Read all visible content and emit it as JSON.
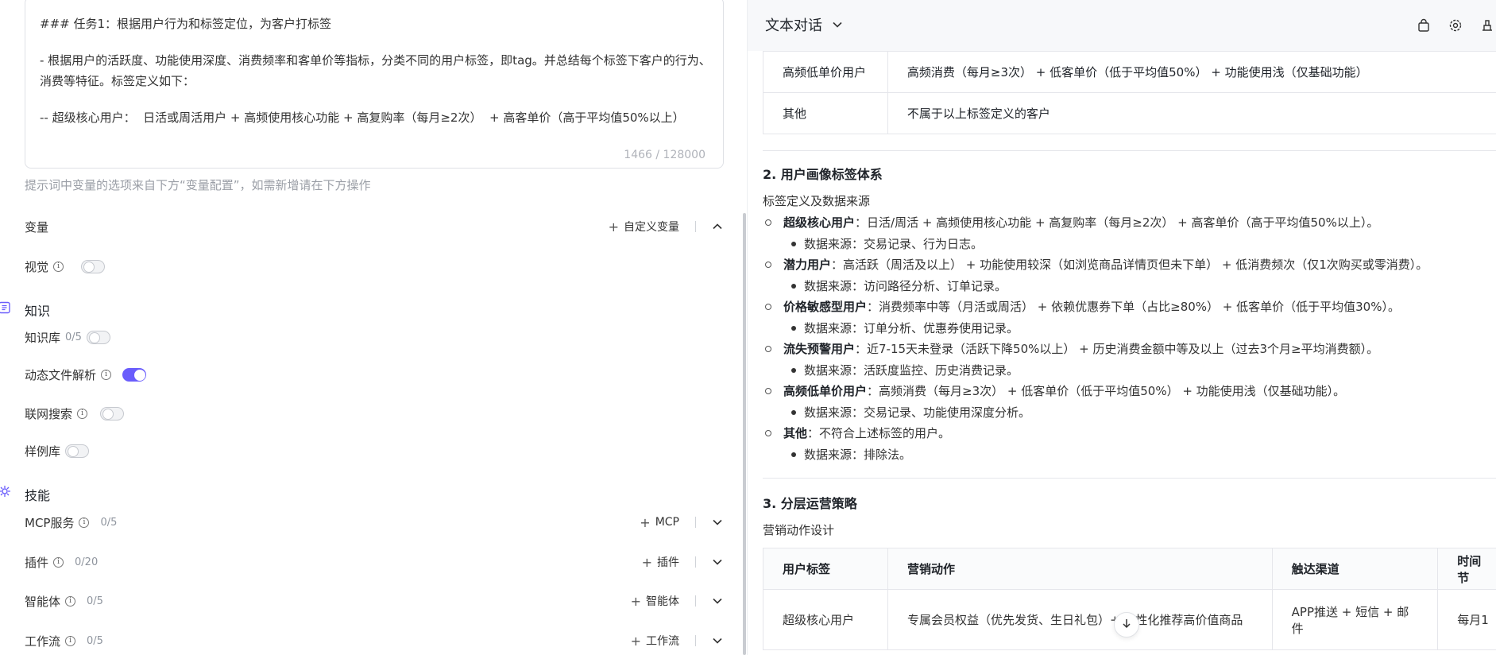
{
  "prompt": {
    "lines": [
      "### 任务1：根据用户行为和标签定位，为客户打标签",
      "- 根据用户的活跃度、功能使用深度、消费频率和客单价等指标，分类不同的用户标签，即tag。并总结每个标签下客户的行为、消费等特征。标签定义如下：",
      "-- 超级核心用户：  日活或周活用户 + 高频使用核心功能 + 高复购率（每月≥2次）  + 高客单价（高于平均值50%以上）"
    ],
    "char_count": "1466 / 128000",
    "hint": "提示词中变量的选项来自下方“变量配置”，如需新增请在下方操作"
  },
  "variables": {
    "label": "变量",
    "add_label": "自定义变量",
    "vision_label": "视觉"
  },
  "knowledge": {
    "title": "知识",
    "kb_label": "知识库",
    "kb_count": "0/5",
    "dynamic_label": "动态文件解析",
    "web_label": "联网搜索",
    "examples_label": "样例库"
  },
  "skills": {
    "title": "技能",
    "items": [
      {
        "label": "MCP服务",
        "count": "0/5",
        "add": "MCP"
      },
      {
        "label": "插件",
        "count": "0/20",
        "add": "插件"
      },
      {
        "label": "智能体",
        "count": "0/5",
        "add": "智能体"
      },
      {
        "label": "工作流",
        "count": "0/5",
        "add": "工作流"
      }
    ]
  },
  "topbar": {
    "title": "文本对话"
  },
  "table1": {
    "rows": [
      {
        "tag": "高频低单价用户",
        "def": "高频消费（每月≥3次）  + 低客单价（低于平均值50%）  + 功能使用浅（仅基础功能）"
      },
      {
        "tag": "其他",
        "def": "不属于以上标签定义的客户"
      }
    ]
  },
  "section2": {
    "title": "2. 用户画像标签体系",
    "subtitle": "标签定义及数据来源",
    "items": [
      {
        "name": "超级核心用户",
        "desc": "：日活/周活 + 高频使用核心功能 + 高复购率（每月≥2次）  + 高客单价（高于平均值50%以上）。",
        "source": "数据来源：交易记录、行为日志。"
      },
      {
        "name": "潜力用户",
        "desc": "：高活跃（周活及以上）  + 功能使用较深（如浏览商品详情页但未下单）  + 低消费频次（仅1次购买或零消费）。",
        "source": "数据来源：访问路径分析、订单记录。"
      },
      {
        "name": "价格敏感型用户",
        "desc": "：消费频率中等（月活或周活）  + 依赖优惠券下单（占比≥80%）  + 低客单价（低于平均值30%）。",
        "source": "数据来源：订单分析、优惠券使用记录。"
      },
      {
        "name": "流失预警用户",
        "desc": "：近7-15天未登录（活跃下降50%以上）  + 历史消费金额中等及以上（过去3个月≥平均消费额）。",
        "source": "数据来源：活跃度监控、历史消费记录。"
      },
      {
        "name": "高频低单价用户",
        "desc": "：高频消费（每月≥3次）  + 低客单价（低于平均值50%）  + 功能使用浅（仅基础功能）。",
        "source": "数据来源：交易记录、功能使用深度分析。"
      },
      {
        "name": "其他",
        "desc": "：不符合上述标签的用户。",
        "source": "数据来源：排除法。"
      }
    ]
  },
  "section3": {
    "title": "3. 分层运营策略",
    "subtitle": "营销动作设计",
    "headers": [
      "用户标签",
      "营销动作",
      "触达渠道",
      "时间节"
    ],
    "row": [
      "超级核心用户",
      "专属会员权益（优先发货、生日礼包）+ 个性化推荐高价值商品",
      "APP推送 + 短信 + 邮件",
      "每月1"
    ]
  },
  "colors": {
    "accent": "#6a5dfc",
    "border": "#e5e6eb"
  }
}
